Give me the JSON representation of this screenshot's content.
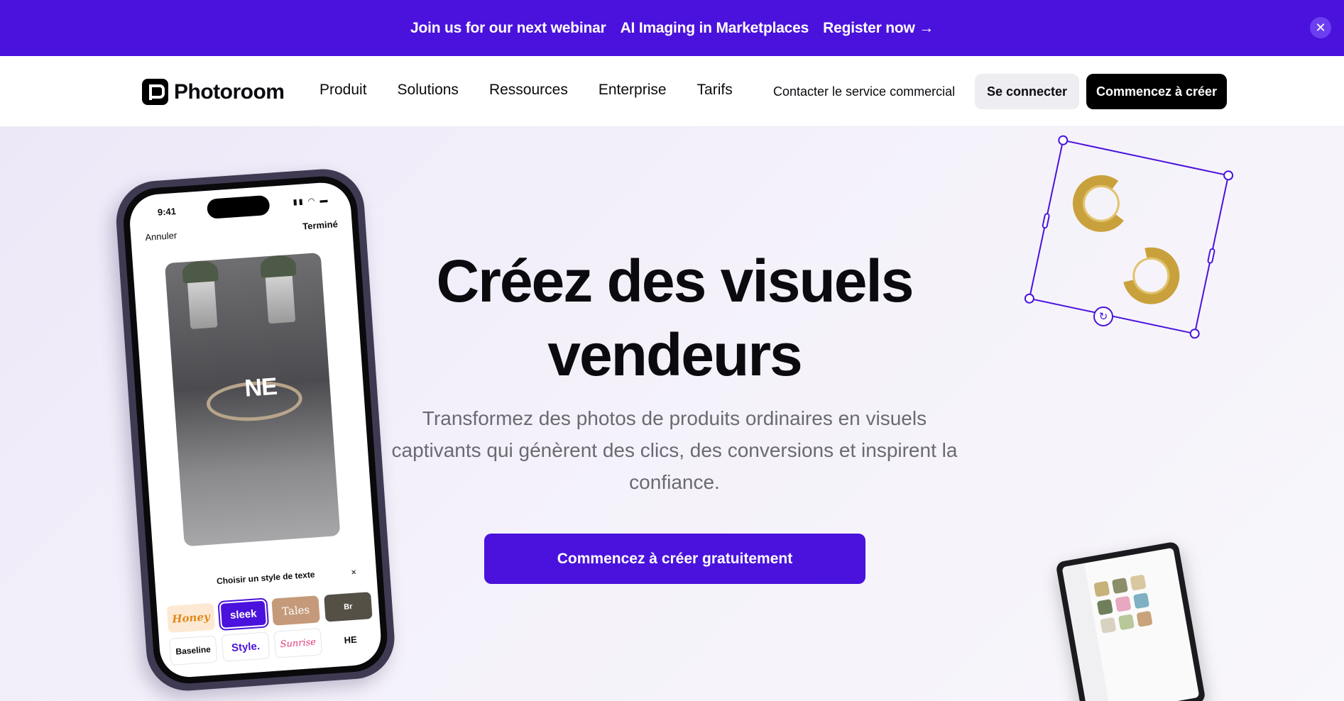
{
  "banner": {
    "lead": "Join us for our next webinar",
    "topic": "AI Imaging in Marketplaces",
    "register": "Register now →",
    "close_icon": "close-icon"
  },
  "header": {
    "logo_text": "Photoroom",
    "nav": [
      "Produit",
      "Solutions",
      "Ressources",
      "Enterprise",
      "Tarifs"
    ],
    "contact": "Contacter le service commercial",
    "login": "Se connecter",
    "start": "Commencez à créer"
  },
  "hero": {
    "title_line1": "Créez des visuels",
    "title_line2": "vendeurs",
    "subtitle": "Transformez des photos de produits ordinaires en visuels captivants qui génèrent des clics, des conversions et inspirent la confiance.",
    "cta": "Commencez à créer gratuitement"
  },
  "phone": {
    "time": "9:41",
    "cancel": "Annuler",
    "done": "Terminé",
    "overlay_text": "NE",
    "style_title": "Choisir un style de texte",
    "style_close": "×",
    "styles": [
      "Honey",
      "sleek",
      "Tales",
      "Br",
      "Baseline",
      "Style.",
      "Sunrise",
      "HE"
    ]
  },
  "colors": {
    "brand": "#4a12dc",
    "black": "#000000",
    "muted_text": "#6a6a72"
  }
}
